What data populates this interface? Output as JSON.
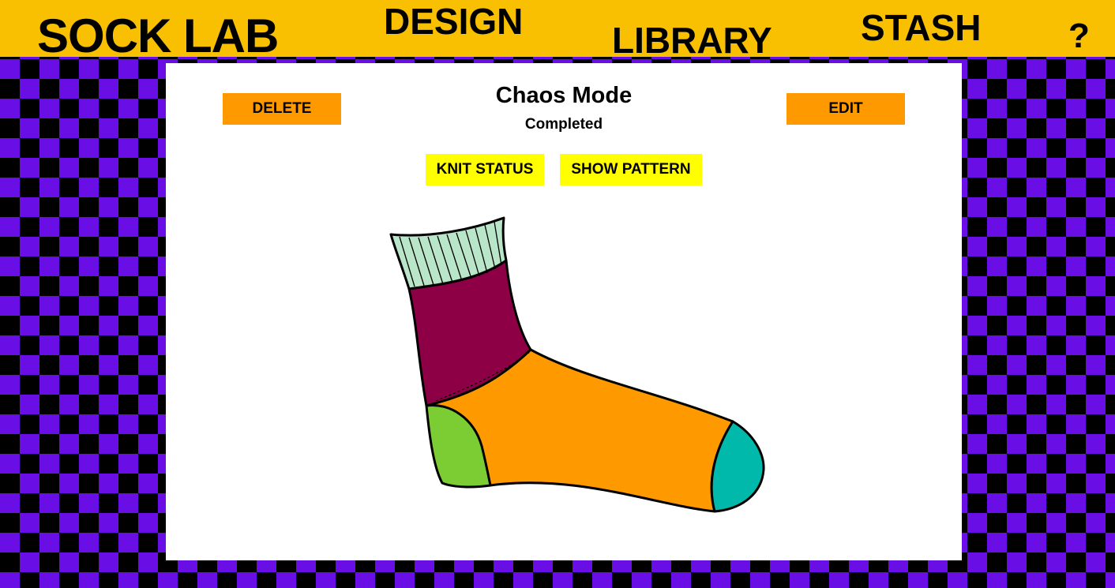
{
  "nav": {
    "logo": "SOCK LAB",
    "design": "DESIGN",
    "library": "LIBRARY",
    "stash": "STASH",
    "help": "?"
  },
  "design": {
    "title": "Chaos Mode",
    "status": "Completed"
  },
  "actions": {
    "delete_label": "DELETE",
    "edit_label": "EDIT",
    "knit_status_label": "KNIT STATUS",
    "show_pattern_label": "SHOW PATTERN"
  },
  "sock_colors": {
    "cuff": "#b9e6c8",
    "leg": "#8e0046",
    "heel": "#7ccc33",
    "foot": "#ff9900",
    "toe": "#00b9aa"
  },
  "colors": {
    "topbar": "#f8c000",
    "checker_a": "#6a0ee6",
    "checker_b": "#000000",
    "primary_button": "#ff9900",
    "secondary_button": "#ffff00"
  },
  "icons": {
    "help": "question-mark"
  }
}
